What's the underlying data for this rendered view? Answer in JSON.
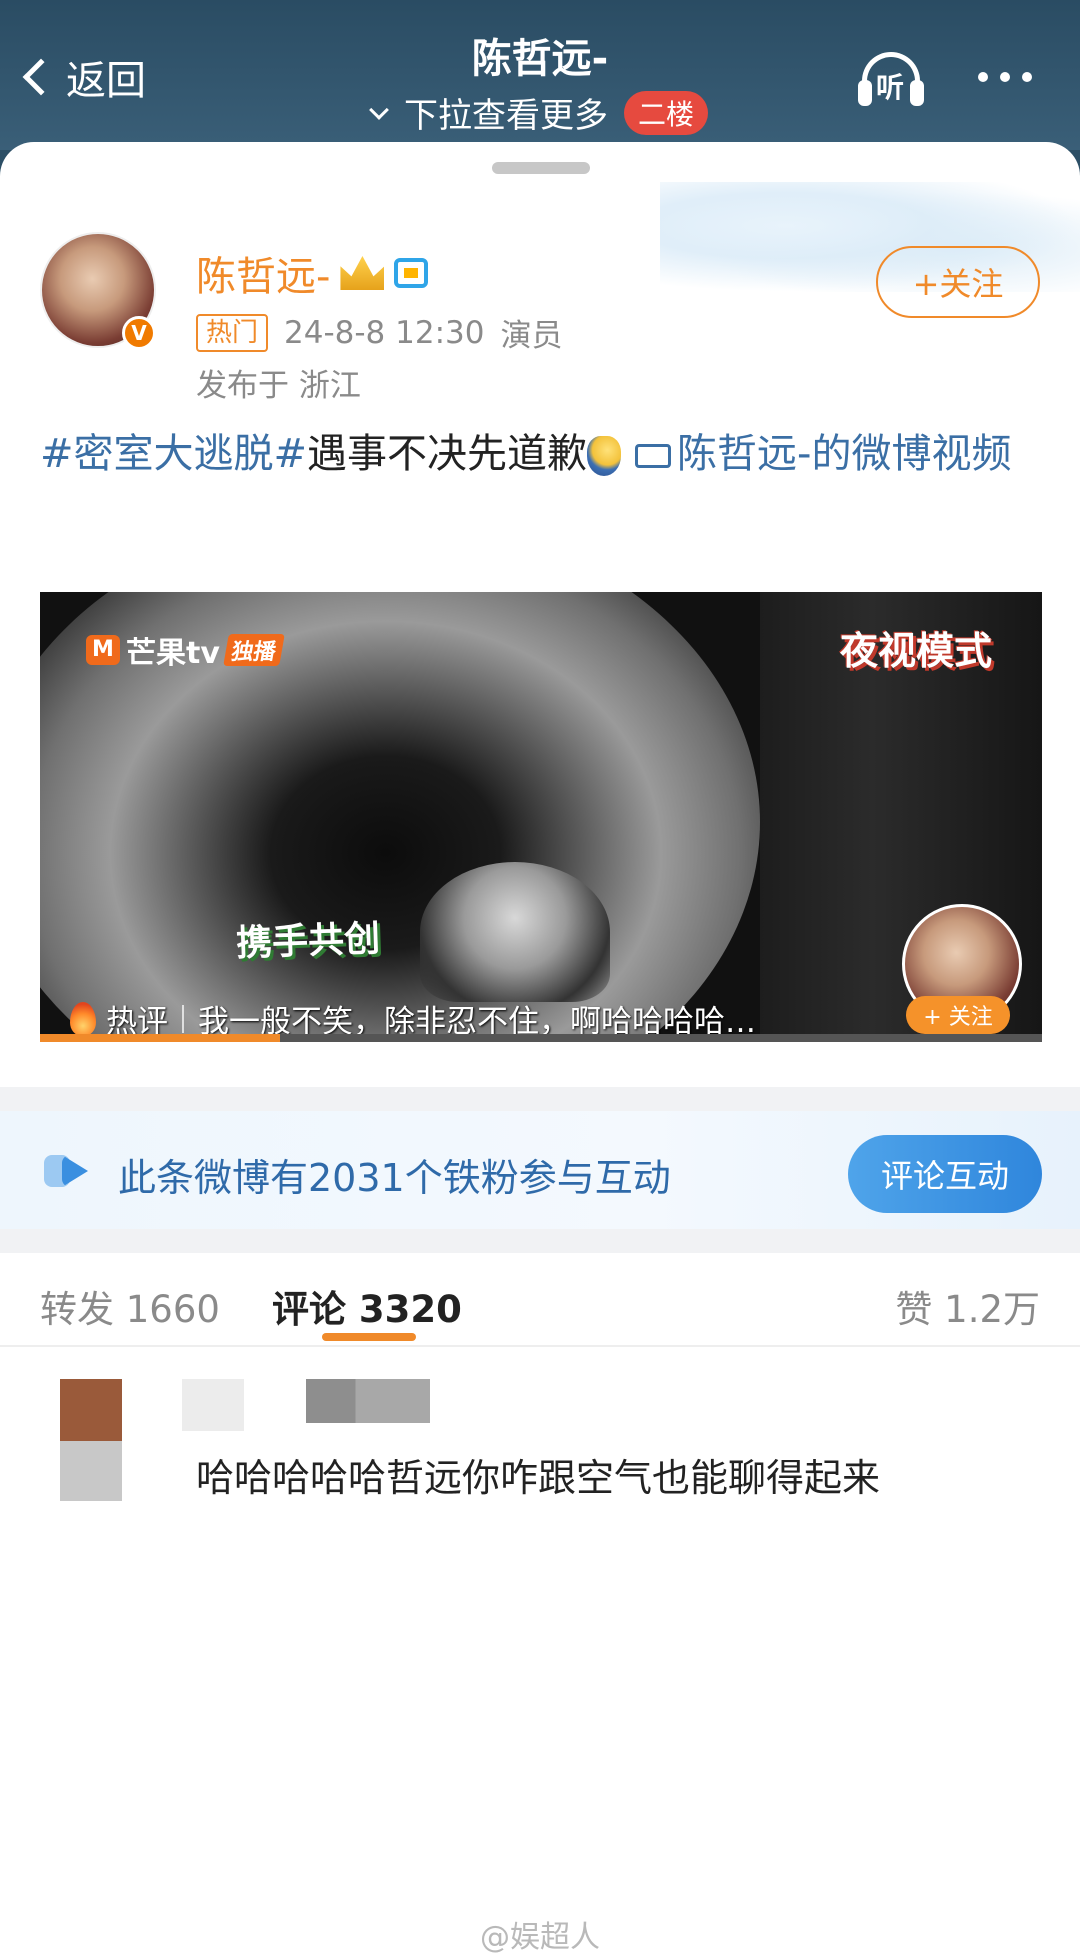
{
  "header": {
    "back_label": "返回",
    "title": "陈哲远-",
    "subtitle": "下拉查看更多",
    "floor_badge": "二楼",
    "listen_label": "听"
  },
  "post": {
    "author_name": "陈哲远-",
    "verified_mark": "V",
    "hot_tag": "热门",
    "timestamp": "24-8-8 12:30",
    "role": "演员",
    "location": "发布于 浙江",
    "follow_label": "+关注",
    "hashtag": "#密室大逃脱#",
    "text": "遇事不决先道歉",
    "video_link": "陈哲远-的微博视频"
  },
  "video": {
    "logo_text": "芒果tv",
    "logo_badge": "独播",
    "mode_label": "夜视模式",
    "subtitle_green": "携手共创",
    "hot_label": "热评",
    "hot_comment": "我一般不笑，除非忍不住，啊哈哈哈哈…",
    "follow_label": "+ 关注",
    "progress": 0.24
  },
  "share": {
    "items": [
      "wechat-icon",
      "moments-icon",
      "qq-icon",
      "save-image-icon"
    ]
  },
  "fans": {
    "text": "此条微博有2031个铁粉参与互动",
    "button": "评论互动"
  },
  "tabs": {
    "repost": "转发 1660",
    "comment": "评论 3320",
    "like": "赞 1.2万"
  },
  "comment": {
    "text": "哈哈哈哈哈哲远你咋跟空气也能聊得起来"
  },
  "watermark": "@娱超人",
  "colors": {
    "accent": "#f08a2a",
    "link": "#3b6fa5",
    "header_bg": "#2c4f66",
    "fans_button": "#3a8fe0"
  }
}
